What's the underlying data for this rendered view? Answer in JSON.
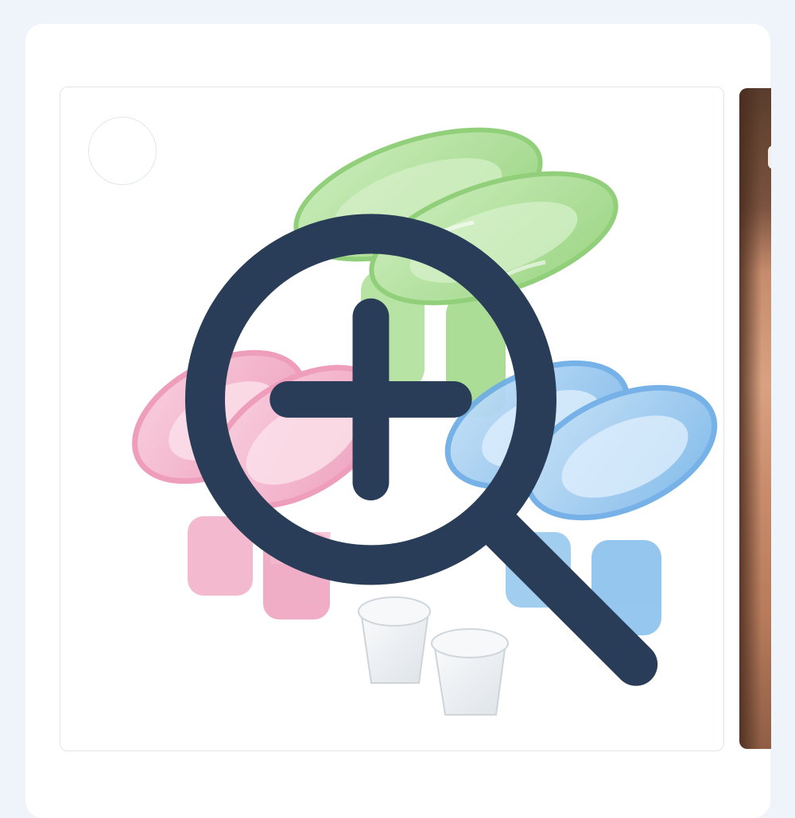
{
  "gallery": {
    "zoom_button": {
      "icon": "zoom-in-icon"
    },
    "main_image": {
      "items": [
        {
          "color_name": "green",
          "color": "#a9dc93"
        },
        {
          "color_name": "pink",
          "color": "#f3a9c4"
        },
        {
          "color_name": "blue",
          "color": "#8cc2ee"
        },
        {
          "color_name": "clear",
          "color": "#eef1f3"
        }
      ]
    },
    "next_thumbnail": {
      "icon": "photo-thumbnail"
    }
  },
  "colors": {
    "page_bg": "#eef4fa",
    "card_bg": "#ffffff",
    "frame_border": "#dfe5ec",
    "zoom_icon_stroke": "#2a3d58"
  }
}
